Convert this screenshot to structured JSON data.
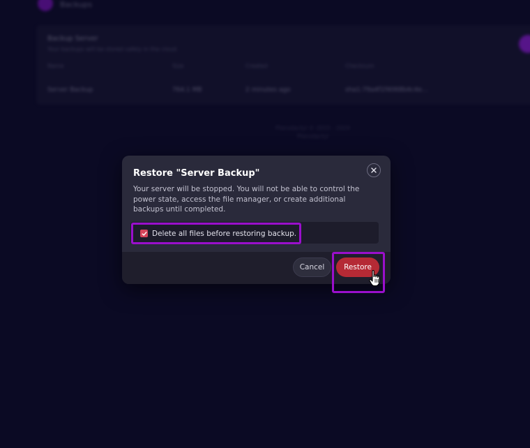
{
  "background": {
    "nav_text": "Backups",
    "panel_title": "Backup Server",
    "panel_subtitle": "Your backups will be stored safely in the cloud.",
    "columns": [
      "Name",
      "Size",
      "Created",
      "Checksum"
    ],
    "row": [
      "Server Backup",
      "764.1 MB",
      "2 minutes ago",
      "sha1:79a4f1f4068b4c4e..."
    ],
    "footer_line1": "Pterodactyl © 2015 - 2024",
    "footer_line2": "Pterodactyl"
  },
  "modal": {
    "title": "Restore \"Server Backup\"",
    "description": "Your server will be stopped. You will not be able to control the power state, access the file manager, or create additional backups until completed.",
    "checkbox_label": "Delete all files before restoring backup.",
    "checkbox_checked": true,
    "cancel_label": "Cancel",
    "restore_label": "Restore",
    "close_icon": "close-icon",
    "checkmark_icon": "checkmark-icon",
    "cursor_icon": "hand-pointer-icon"
  },
  "colors": {
    "page_background": "#0b0a24",
    "modal_background": "#2a2a3b",
    "highlight_border": "#9a0fcc",
    "restore_button": "#b52a35",
    "checkbox": "#d6455b"
  }
}
